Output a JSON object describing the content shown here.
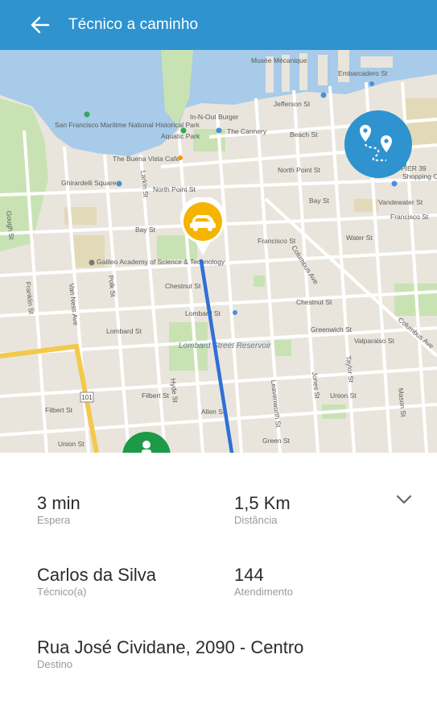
{
  "appbar": {
    "title": "Técnico a caminho",
    "back_icon": "arrow-left-icon",
    "color": "#2e93cf"
  },
  "map": {
    "labels": {
      "museum": "Musée Mécanique",
      "embarcadero": "Embarcadero St",
      "jefferson": "Jefferson St",
      "in_n_out": "In-N-Out Burger",
      "maritime": "San Francisco Maritime National Historical Park",
      "aquatic_park": "Aquatic Park",
      "cannery": "The Cannery",
      "beach_st": "Beach St",
      "buena_vista": "The Buena Vista Cafe",
      "ghirardelli": "Ghirardelli Square",
      "north_point": "North Point St",
      "larkin": "Larkin St",
      "hyde": "Hyde St",
      "bay_st": "Bay St",
      "francisco_st": "Francisco St",
      "columbus": "Columbus Ave",
      "water_st": "Water St",
      "vandewater": "Vandewater St",
      "pier39": "PIER 39",
      "shopping": "Shopping Ce",
      "galileo": "Galileo Academy of Science & Technology",
      "chestnut": "Chestnut St",
      "lombard_st": "Lombard St",
      "lombard_reservoir": "Lombard Street Reservoir",
      "greenwich": "Greenwich St",
      "valparaiso": "Valparaiso St",
      "filbert": "Filbert St",
      "union": "Union St",
      "green": "Green St",
      "allen": "Allen St",
      "leavenworth": "Leavenworth St",
      "jones": "Jones St",
      "taylor": "Taylor St",
      "mason": "Mason St",
      "polk": "Polk St",
      "van_ness": "Van Ness Ave",
      "franklin": "Franklin St",
      "gough": "Gough St",
      "highway": "101"
    },
    "route_button_icon": "route-icon",
    "vehicle_icon": "car-icon",
    "destination_icon": "person-pin-icon",
    "colors": {
      "route": "#2f6fd8",
      "vehicle": "#f4b400",
      "destination": "#1e9a47",
      "route_button": "#2e93cf",
      "highway": "#f2c94c"
    }
  },
  "details": {
    "wait_value": "3 min",
    "wait_label": "Espera",
    "distance_value": "1,5 Km",
    "distance_label": "Distância",
    "expand_icon": "chevron-down-icon",
    "technician_value": "Carlos da Silva",
    "technician_label": "Técnico(a)",
    "service_value": "144",
    "service_label": "Atendimento",
    "destination_value": "Rua José Cividane, 2090 - Centro",
    "destination_label": "Destino"
  }
}
